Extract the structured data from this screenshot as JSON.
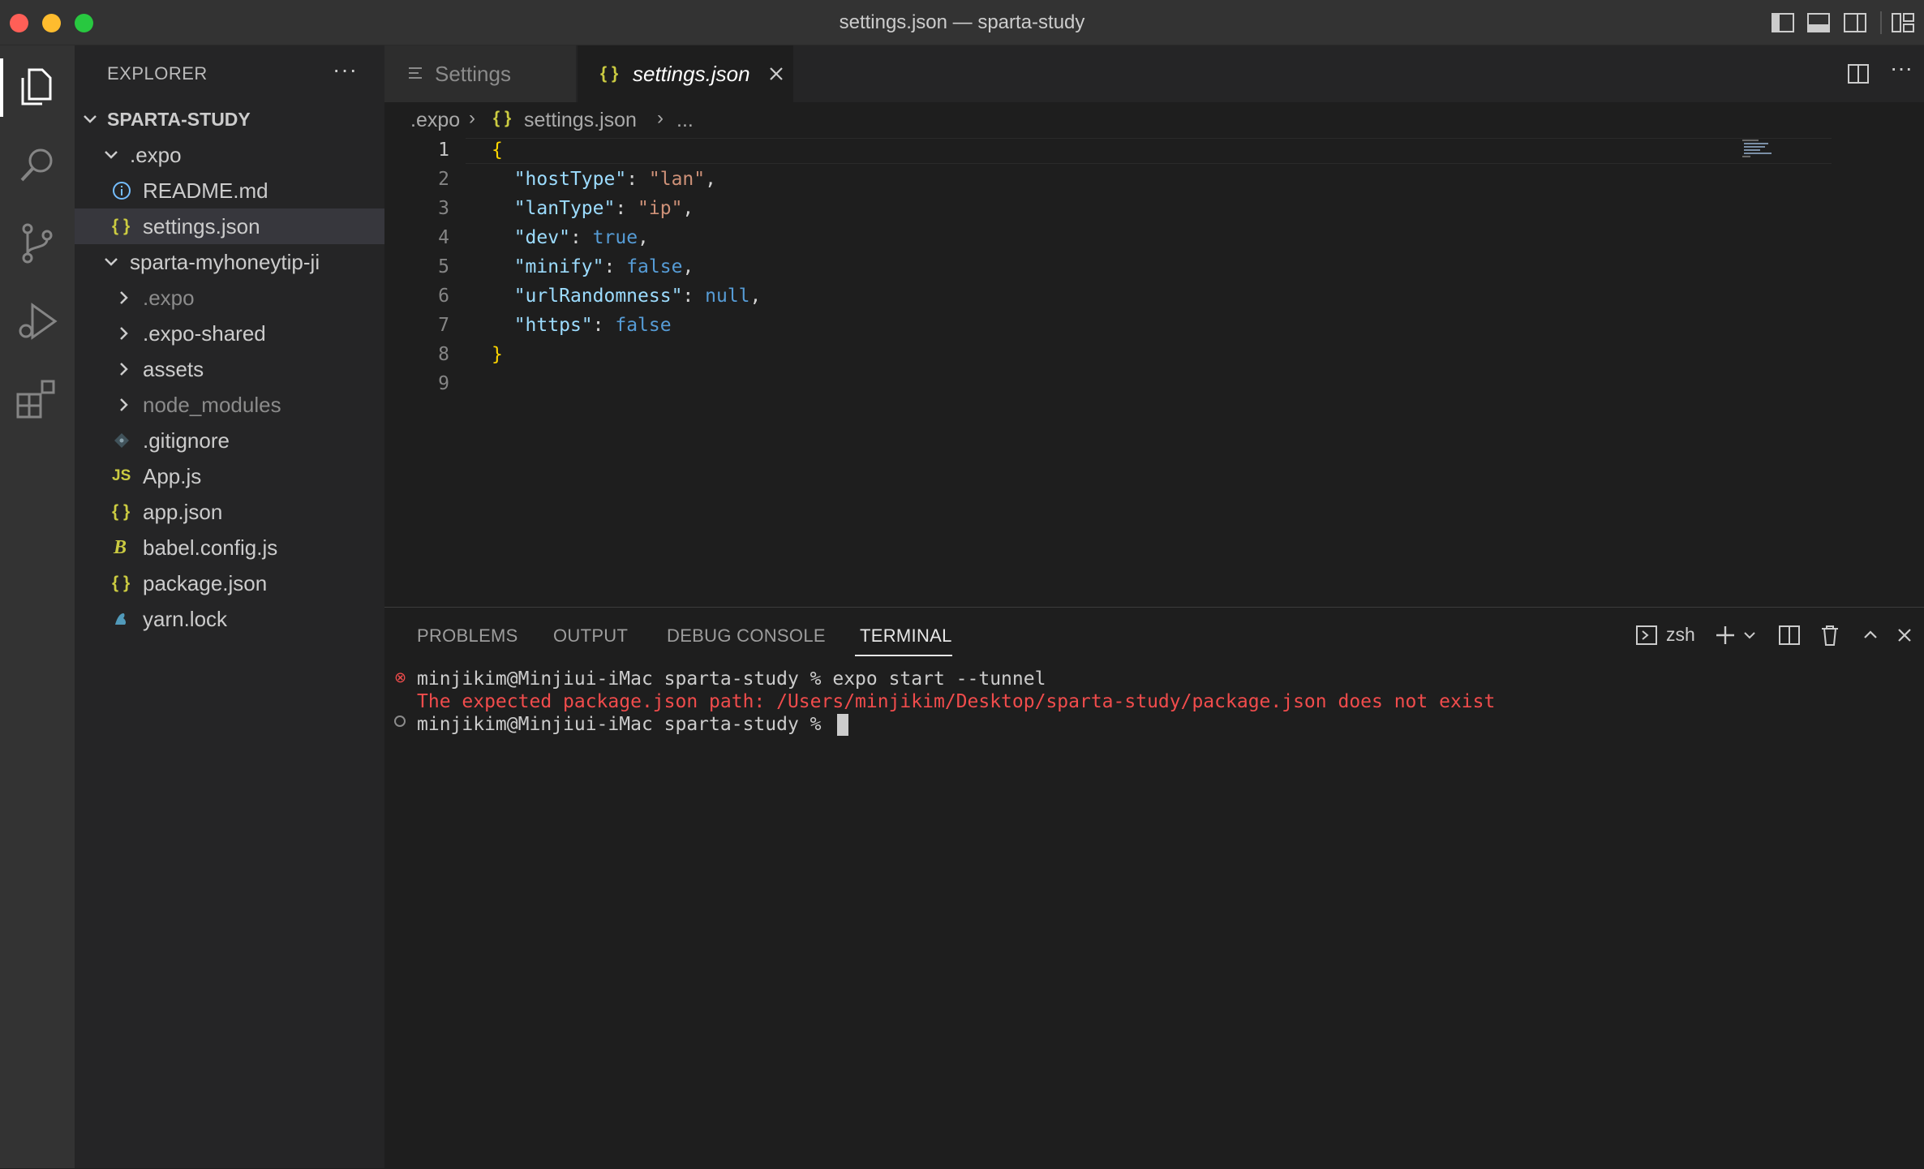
{
  "window": {
    "title": "settings.json — sparta-study"
  },
  "colors": {
    "close": "#ff5f57",
    "minimize": "#febc2e",
    "maximize": "#28c840",
    "accent": "#007acc",
    "error": "#f14c4c"
  },
  "activity_bar": {
    "items": [
      "explorer-icon",
      "search-icon",
      "source-control-icon",
      "run-debug-icon",
      "extensions-icon"
    ]
  },
  "explorer": {
    "title": "EXPLORER",
    "more": "···",
    "root": "SPARTA-STUDY",
    "items": [
      {
        "label": ".expo",
        "icon": "chevron-down"
      },
      {
        "label": "README.md",
        "icon": "info"
      },
      {
        "label": "settings.json",
        "icon": "{ }"
      },
      {
        "label": "sparta-myhoneytip-ji",
        "icon": "chevron-down"
      },
      {
        "label": ".expo",
        "icon": "chevron-right"
      },
      {
        "label": ".expo-shared",
        "icon": "chevron-right"
      },
      {
        "label": "assets",
        "icon": "chevron-right"
      },
      {
        "label": "node_modules",
        "icon": "chevron-right"
      },
      {
        "label": ".gitignore",
        "icon": "git"
      },
      {
        "label": "App.js",
        "icon": "JS"
      },
      {
        "label": "app.json",
        "icon": "{ }"
      },
      {
        "label": "babel.config.js",
        "icon": "B"
      },
      {
        "label": "package.json",
        "icon": "{ }"
      },
      {
        "label": "yarn.lock",
        "icon": "yarn"
      }
    ]
  },
  "tabs": [
    {
      "label": "Settings"
    },
    {
      "label": "settings.json"
    }
  ],
  "breadcrumbs": {
    "folder": ".expo",
    "file": "settings.json",
    "more": "..."
  },
  "editor": {
    "line_numbers": [
      "1",
      "2",
      "3",
      "4",
      "5",
      "6",
      "7",
      "8",
      "9"
    ],
    "lines": {
      "l1": "{",
      "l2": {
        "key": "\"hostType\"",
        "colon": ": ",
        "value": "\"lan\"",
        "comma": ","
      },
      "l3": {
        "key": "\"lanType\"",
        "colon": ": ",
        "value": "\"ip\"",
        "comma": ","
      },
      "l4": {
        "key": "\"dev\"",
        "colon": ": ",
        "value": "true",
        "comma": ","
      },
      "l5": {
        "key": "\"minify\"",
        "colon": ": ",
        "value": "false",
        "comma": ","
      },
      "l6": {
        "key": "\"urlRandomness\"",
        "colon": ": ",
        "value": "null",
        "comma": ","
      },
      "l7": {
        "key": "\"https\"",
        "colon": ": ",
        "value": "false"
      },
      "l8": "}"
    }
  },
  "panel": {
    "tabs": [
      "PROBLEMS",
      "OUTPUT",
      "DEBUG CONSOLE",
      "TERMINAL"
    ],
    "shell": "zsh",
    "terminal": {
      "line1": "minjikim@Minjiui-iMac sparta-study % expo start --tunnel",
      "line2": "The expected package.json path: /Users/minjikim/Desktop/sparta-study/package.json does not exist",
      "line3": "minjikim@Minjiui-iMac sparta-study % "
    }
  }
}
